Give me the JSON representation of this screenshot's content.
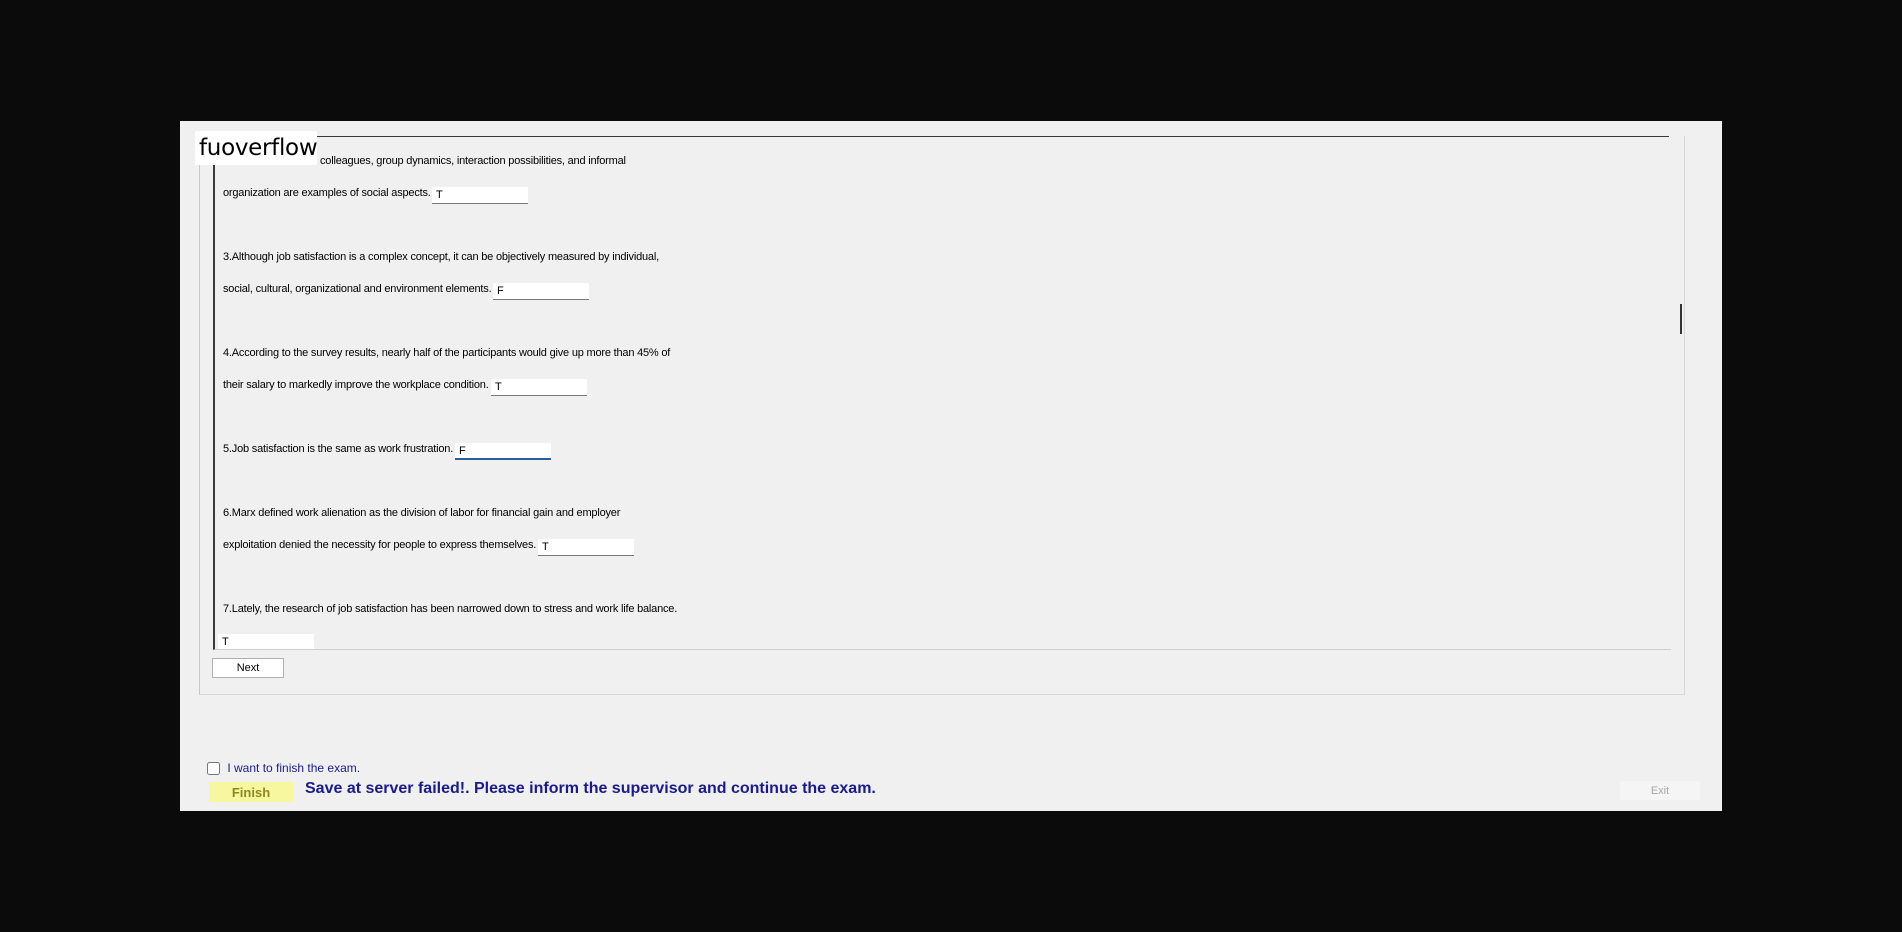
{
  "app": {
    "logo": "fuoverflow"
  },
  "questions": {
    "q2_line1": "colleagues, group dynamics, interaction possibilities, and informal",
    "q2_line2": "organization are examples of social aspects.",
    "q2_answer": "T",
    "q3_line1": "3.Although job satisfaction is a complex concept, it can be objectively measured by individual,",
    "q3_line2": "social, cultural, organizational and environment elements.",
    "q3_answer": "F",
    "q4_line1": "4.According to the survey results, nearly half of the participants would give up more than 45% of",
    "q4_line2": "their salary to markedly improve the workplace condition.",
    "q4_answer": "T",
    "q5_line1": "5.Job satisfaction is the same as work frustration.",
    "q5_answer": "F",
    "q6_line1": "6.Marx defined work alienation as the division of labor for financial gain and employer",
    "q6_line2": "exploitation denied the necessity for people to express themselves.",
    "q6_answer": "T",
    "q7_line1": "7.Lately, the research of job satisfaction has been narrowed down to stress and work life balance.",
    "q7_answer": "T"
  },
  "controls": {
    "next_label": "Next",
    "finish_checkbox_label": "I want to finish the exam.",
    "finish_label": "Finish",
    "status_message": "Save at server failed!. Please inform the supervisor and continue the exam.",
    "exit_label": "Exit"
  }
}
